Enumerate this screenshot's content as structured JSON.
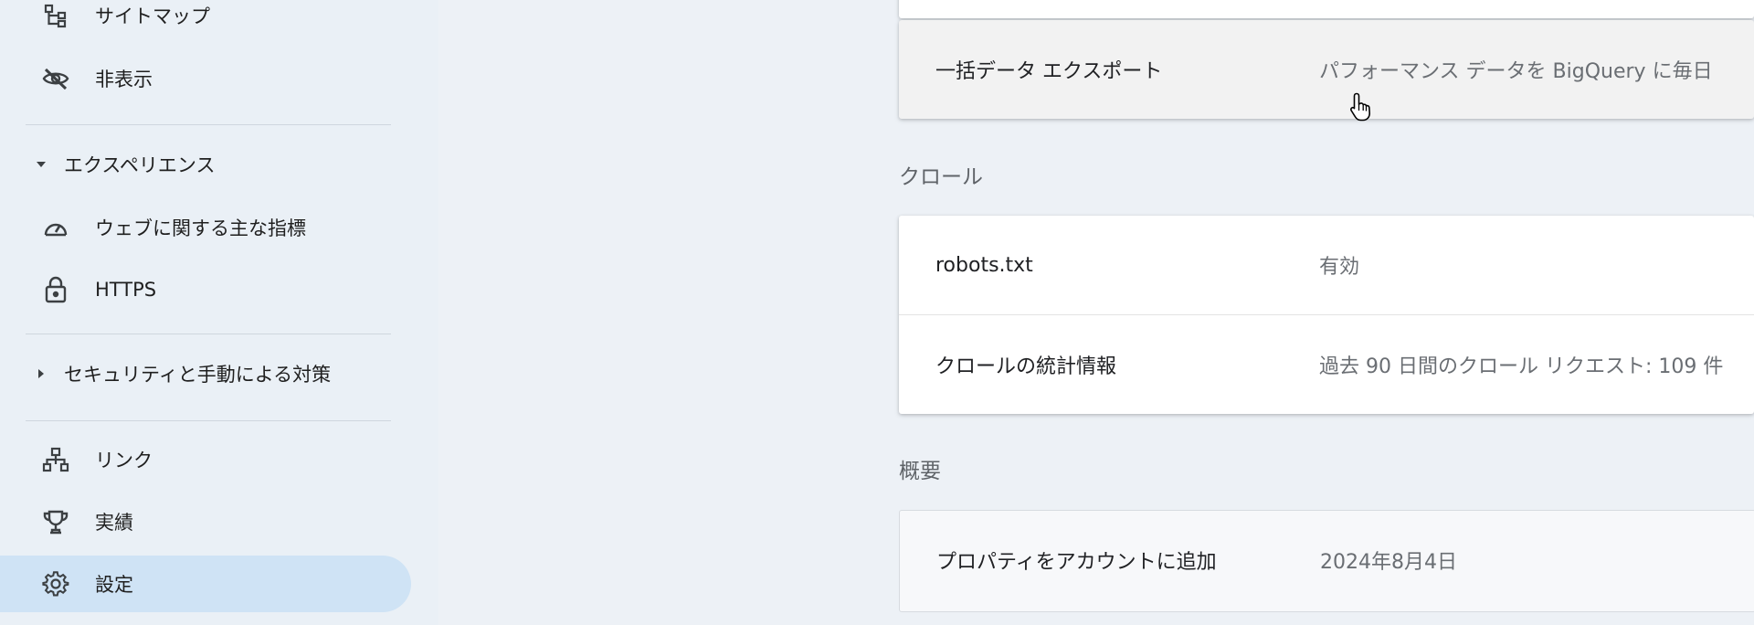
{
  "sidebar": {
    "items_top": [
      {
        "label": "サイトマップ",
        "icon": "sitemap-icon"
      },
      {
        "label": "非表示",
        "icon": "eye-off-icon"
      }
    ],
    "experience": {
      "label": "エクスペリエンス",
      "items": [
        {
          "label": "ウェブに関する主な指標",
          "icon": "speedometer-icon"
        },
        {
          "label": "HTTPS",
          "icon": "lock-icon"
        }
      ]
    },
    "security": {
      "label": "セキュリティと手動による対策"
    },
    "items_bottom": [
      {
        "label": "リンク",
        "icon": "links-icon"
      },
      {
        "label": "実績",
        "icon": "trophy-icon"
      },
      {
        "label": "設定",
        "icon": "gear-icon"
      }
    ]
  },
  "main": {
    "export_row": {
      "name": "一括データ エクスポート",
      "value": "パフォーマンス データを BigQuery に毎日"
    },
    "crawl": {
      "title": "クロール",
      "rows": [
        {
          "name": "robots.txt",
          "value": "有効"
        },
        {
          "name": "クロールの統計情報",
          "value": "過去 90 日間のクロール リクエスト: 109 件"
        }
      ]
    },
    "overview": {
      "title": "概要",
      "rows": [
        {
          "name": "プロパティをアカウントに追加",
          "value": "2024年8月4日"
        }
      ]
    }
  },
  "colors": {
    "active_bg": "#cfe3f5",
    "page_bg": "#edf1f6"
  }
}
